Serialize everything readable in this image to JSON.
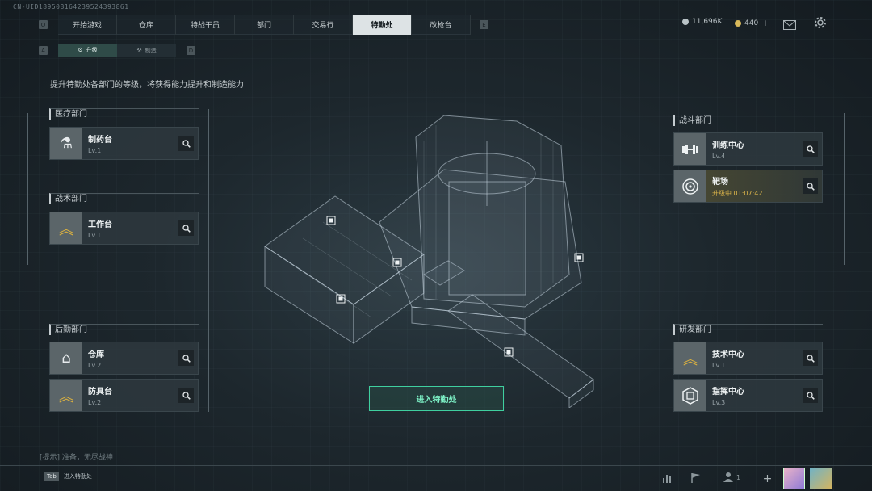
{
  "uid": "CN-UID189508164239524393861",
  "nav": {
    "left_key": "Q",
    "right_key": "E",
    "tabs": [
      "开始游戏",
      "仓库",
      "特战干员",
      "部门",
      "交易行",
      "特勤处",
      "改枪台"
    ],
    "active_index": 5
  },
  "currency": {
    "coins": "11,696K",
    "tickets": "440",
    "add": "+"
  },
  "subnav": {
    "left_key": "A",
    "right_key": "D",
    "tabs": [
      "升级",
      "制造"
    ],
    "active_index": 0
  },
  "description": "提升特勤处各部门的等级，将获得能力提升和制造能力",
  "departments": {
    "medical": {
      "title": "医疗部门",
      "items": [
        {
          "name": "制药台",
          "level": "Lv.1",
          "icon": "medicine-icon"
        }
      ]
    },
    "tactical": {
      "title": "战术部门",
      "items": [
        {
          "name": "工作台",
          "level": "Lv.1",
          "icon": "workbench-icon"
        }
      ]
    },
    "logistics": {
      "title": "后勤部门",
      "items": [
        {
          "name": "仓库",
          "level": "Lv.2",
          "icon": "storage-icon"
        },
        {
          "name": "防具台",
          "level": "Lv.2",
          "icon": "armor-icon"
        }
      ]
    },
    "combat": {
      "title": "战斗部门",
      "items": [
        {
          "name": "训练中心",
          "level": "Lv.4",
          "icon": "dumbbell-icon"
        },
        {
          "name": "靶场",
          "level": "升级中 01:07:42",
          "icon": "target-icon"
        }
      ]
    },
    "research": {
      "title": "研发部门",
      "items": [
        {
          "name": "技术中心",
          "level": "Lv.1",
          "icon": "tech-icon"
        },
        {
          "name": "指挥中心",
          "level": "Lv.3",
          "icon": "command-icon"
        }
      ]
    }
  },
  "enter_button": "进入特勤处",
  "tip": "[提示] 准备，无尽战神",
  "bottom_hint": {
    "key": "Tab",
    "label": "进入特勤处"
  },
  "squad_count": "1",
  "colors": {
    "accent": "#3fcf9f",
    "active_tab": "#dde3e5",
    "timer": "#d9b34a"
  }
}
